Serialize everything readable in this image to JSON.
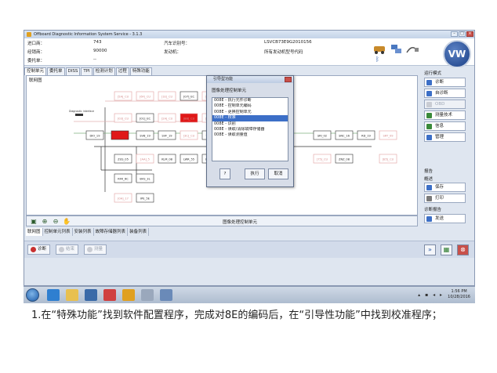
{
  "window": {
    "title": "Offboard Diagnostic Information System Service - 3.1.3"
  },
  "info": {
    "rows": [
      {
        "label": "进口商：",
        "value": "743"
      },
      {
        "label": "经销商：",
        "value": "90000"
      },
      {
        "label": "委托单：",
        "value": "--"
      }
    ],
    "vin_label": "汽车识别号：",
    "vin_value": "LSVCB73E9G2010156",
    "engine_label": "发动机：",
    "engine_value": "所有发动机型号代码"
  },
  "tabs": [
    "控制单元",
    "委托单",
    "DISS",
    "TPI",
    "检测计划",
    "过程",
    "特殊功能"
  ],
  "panel": {
    "title": "联网图",
    "caption": "图像处理控制单元"
  },
  "diagram": {
    "top_row": [
      "5L_ECU",
      "[5A]_CU",
      "[6F]_CU",
      "[1E]_CU",
      "[07]_EC",
      "[D1]_CU",
      "[BA]_CU",
      "[10]_CU",
      "[22]_CU",
      "[45]_CU",
      "[7E]_CU"
    ],
    "row2": [
      "[03]_CU",
      "[01]_EC",
      "[2A]_CU",
      "[8B]_CU",
      "[14]_CU",
      "[7A]_SC"
    ],
    "row3": [
      "DIO_19",
      "",
      "SVB_19",
      "SVF_19",
      "[3C]_CU",
      "TFA_42",
      "FRO_07"
    ],
    "row3_right": [
      "SRI_02",
      "SNC_16",
      "RD_19",
      "SRT_09"
    ],
    "row4": [
      "ZUS_05",
      "[AA]_5",
      "KLM_08",
      "LWR_55",
      "EZS_05",
      "[8E]_FU"
    ],
    "row4_right": [
      "[75]_CU",
      "ZNZ_08",
      "[B5]_CU"
    ],
    "row5": [
      "RFK_6C",
      "BVS_3L"
    ],
    "row6": [
      "[0A]_17",
      "IPE_5E"
    ],
    "gateway_label": "Diagnostic interface"
  },
  "subtabs": [
    "联网图",
    "控制单元列表",
    "安装列表",
    "故障存储器列表",
    "装备列表"
  ],
  "bottom": {
    "diagnose": "诊断",
    "stop": "结束",
    "report": "测量"
  },
  "sidebar": {
    "mode_title": "运行模式",
    "buttons": [
      {
        "label": "诊断",
        "icon": "diagnose-icon",
        "enabled": true
      },
      {
        "label": "自诊断",
        "icon": "selfdiag-icon",
        "enabled": true
      },
      {
        "label": "OBD",
        "icon": "obd-icon",
        "enabled": false
      },
      {
        "label": "测量技术",
        "icon": "measure-icon",
        "enabled": true
      },
      {
        "label": "信息",
        "icon": "info-icon",
        "enabled": true
      },
      {
        "label": "管理",
        "icon": "admin-icon",
        "enabled": true
      }
    ],
    "report_title": "报告",
    "summary": "概述",
    "report_buttons": [
      {
        "label": "保存",
        "icon": "save-icon"
      },
      {
        "label": "打印",
        "icon": "print-icon"
      }
    ],
    "diag_report": "诊断报告",
    "send": "发送"
  },
  "dialog": {
    "title": "引导型功能",
    "heading": "图像处理控制单元",
    "items": [
      "008E - 执行元件诊断",
      "008E - 控制单元编码",
      "008E - 更换控制单元",
      "008E - 校准",
      "008E - 识别",
      "008E - 读取/清除故障存储器",
      "008E - 读取测量值"
    ],
    "selected_index": 3,
    "buttons": {
      "help": "?",
      "execute": "执行",
      "cancel": "取消"
    }
  },
  "taskbar": {
    "time": "1:56 PM",
    "date": "10/28/2016"
  },
  "caption": "1.在“特殊功能”找到软件配置程序，完成对8E的编码后，在“引导性功能”中找到校准程序；",
  "colors": {
    "accent": "#3c6fc7",
    "fault": "#e01818",
    "vw_blue": "#1a3f86"
  }
}
